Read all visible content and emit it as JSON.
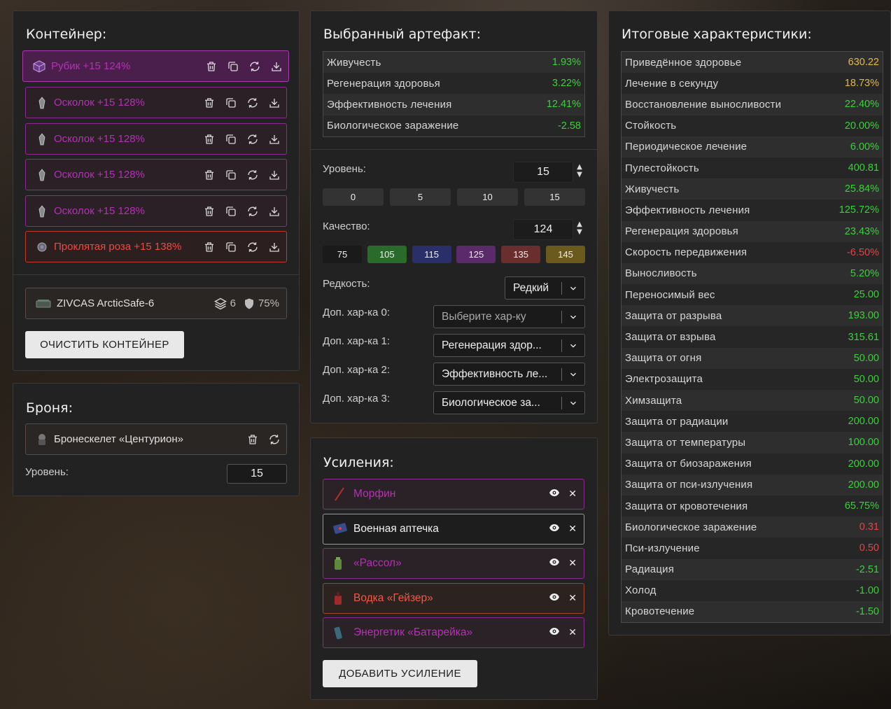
{
  "container": {
    "title": "Контейнер:",
    "artifacts": [
      {
        "name": "Рубик +15 124%",
        "icon": "cube-artifact-icon"
      },
      {
        "name": "Осколок +15 128%",
        "icon": "shard-artifact-icon"
      },
      {
        "name": "Осколок +15 128%",
        "icon": "shard-artifact-icon"
      },
      {
        "name": "Осколок +15 128%",
        "icon": "shard-artifact-icon"
      },
      {
        "name": "Осколок +15 128%",
        "icon": "shard-artifact-icon"
      },
      {
        "name": "Проклятая роза +15 138%",
        "icon": "rose-artifact-icon"
      }
    ],
    "box": {
      "name": "ZIVCAS ArcticSafe-6",
      "slots": "6",
      "protection": "75%"
    },
    "clear_button": "ОЧИСТИТЬ КОНТЕЙНЕР"
  },
  "armor": {
    "title": "Броня:",
    "name": "Бронескелет «Центурион»",
    "level_label": "Уровень:",
    "level_value": "15"
  },
  "artifact": {
    "title": "Выбранный артефакт:",
    "stats": [
      {
        "k": "Живучесть",
        "v": "1.93%"
      },
      {
        "k": "Регенерация здоровья",
        "v": "3.22%"
      },
      {
        "k": "Эффективность лечения",
        "v": "12.41%"
      },
      {
        "k": "Биологическое заражение",
        "v": "-2.58"
      }
    ],
    "level_label": "Уровень:",
    "level_value": "15",
    "level_presets": [
      "0",
      "5",
      "10",
      "15"
    ],
    "quality_label": "Качество:",
    "quality_value": "124",
    "quality_presets": [
      {
        "label": "75",
        "color": "#1a1a1a"
      },
      {
        "label": "105",
        "color": "#2a6a2a"
      },
      {
        "label": "115",
        "color": "#2a2f6a"
      },
      {
        "label": "125",
        "color": "#5a2a6a"
      },
      {
        "label": "135",
        "color": "#6a2e2e"
      },
      {
        "label": "145",
        "color": "#6a5a1e"
      }
    ],
    "rarity_label": "Редкость:",
    "rarity_value": "Редкий",
    "extra": [
      {
        "label": "Доп. хар-ка 0:",
        "value": "Выберите хар-ку",
        "placeholder": true
      },
      {
        "label": "Доп. хар-ка 1:",
        "value": "Регенерация здор...",
        "placeholder": false
      },
      {
        "label": "Доп. хар-ка 2:",
        "value": "Эффективность ле...",
        "placeholder": false
      },
      {
        "label": "Доп. хар-ка 3:",
        "value": "Биологическое за...",
        "placeholder": false
      }
    ]
  },
  "boosts": {
    "title": "Усиления:",
    "items": [
      {
        "name": "Морфин",
        "style": "purple"
      },
      {
        "name": "Военная аптечка",
        "style": "active"
      },
      {
        "name": "«Рассол»",
        "style": "purple"
      },
      {
        "name": "Водка «Гейзер»",
        "style": "orange"
      },
      {
        "name": "Энергетик «Батарейка»",
        "style": "purple"
      }
    ],
    "add_button": "ДОБАВИТЬ УСИЛЕНИЕ"
  },
  "summary": {
    "title": "Итоговые характеристики:",
    "stats": [
      {
        "k": "Приведённое здоровье",
        "v": "630.22",
        "c": "yellow"
      },
      {
        "k": "Лечение в секунду",
        "v": "18.73%",
        "c": "yellow"
      },
      {
        "k": "Восстановление выносливости",
        "v": "22.40%",
        "c": "green"
      },
      {
        "k": "Стойкость",
        "v": "20.00%",
        "c": "green"
      },
      {
        "k": "Периодическое лечение",
        "v": "6.00%",
        "c": "green"
      },
      {
        "k": "Пулестойкость",
        "v": "400.81",
        "c": "green"
      },
      {
        "k": "Живучесть",
        "v": "25.84%",
        "c": "green"
      },
      {
        "k": "Эффективность лечения",
        "v": "125.72%",
        "c": "green"
      },
      {
        "k": "Регенерация здоровья",
        "v": "23.43%",
        "c": "green"
      },
      {
        "k": "Скорость передвижения",
        "v": "-6.50%",
        "c": "red"
      },
      {
        "k": "Выносливость",
        "v": "5.20%",
        "c": "green"
      },
      {
        "k": "Переносимый вес",
        "v": "25.00",
        "c": "green"
      },
      {
        "k": "Защита от разрыва",
        "v": "193.00",
        "c": "green"
      },
      {
        "k": "Защита от взрыва",
        "v": "315.61",
        "c": "green"
      },
      {
        "k": "Защита от огня",
        "v": "50.00",
        "c": "green"
      },
      {
        "k": "Электрозащита",
        "v": "50.00",
        "c": "green"
      },
      {
        "k": "Химзащита",
        "v": "50.00",
        "c": "green"
      },
      {
        "k": "Защита от радиации",
        "v": "200.00",
        "c": "green"
      },
      {
        "k": "Защита от температуры",
        "v": "100.00",
        "c": "green"
      },
      {
        "k": "Защита от биозаражения",
        "v": "200.00",
        "c": "green"
      },
      {
        "k": "Защита от пси-излучения",
        "v": "200.00",
        "c": "green"
      },
      {
        "k": "Защита от кровотечения",
        "v": "65.75%",
        "c": "green"
      },
      {
        "k": "Биологическое заражение",
        "v": "0.31",
        "c": "red"
      },
      {
        "k": "Пси-излучение",
        "v": "0.50",
        "c": "red"
      },
      {
        "k": "Радиация",
        "v": "-2.51",
        "c": "green"
      },
      {
        "k": "Холод",
        "v": "-1.00",
        "c": "green"
      },
      {
        "k": "Кровотечение",
        "v": "-1.50",
        "c": "green"
      }
    ]
  }
}
